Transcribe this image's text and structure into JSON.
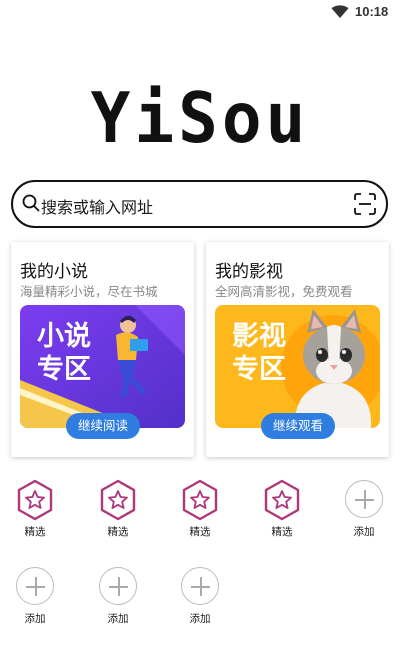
{
  "status_bar": {
    "time": "10:18"
  },
  "logo": {
    "text": "YiSou"
  },
  "search": {
    "placeholder": "搜索或输入网址"
  },
  "cards": [
    {
      "title": "我的小说",
      "subtitle": "海量精彩小说，尽在书城",
      "banner_text_1": "小说",
      "banner_text_2": "专区",
      "button": "继续阅读"
    },
    {
      "title": "我的影视",
      "subtitle": "全网高清影视，免费观看",
      "banner_text_1": "影视",
      "banner_text_2": "专区",
      "button": "继续观看"
    }
  ],
  "shortcuts": [
    {
      "label": "精选",
      "type": "featured"
    },
    {
      "label": "精选",
      "type": "featured"
    },
    {
      "label": "精选",
      "type": "featured"
    },
    {
      "label": "精选",
      "type": "featured"
    },
    {
      "label": "添加",
      "type": "add"
    },
    {
      "label": "添加",
      "type": "add"
    },
    {
      "label": "添加",
      "type": "add"
    },
    {
      "label": "添加",
      "type": "add"
    }
  ],
  "colors": {
    "accent_blue": "#2f7de1",
    "featured_icon": "#b0367a",
    "novel_banner": "#6a39d8",
    "video_banner": "#ffb81c"
  }
}
